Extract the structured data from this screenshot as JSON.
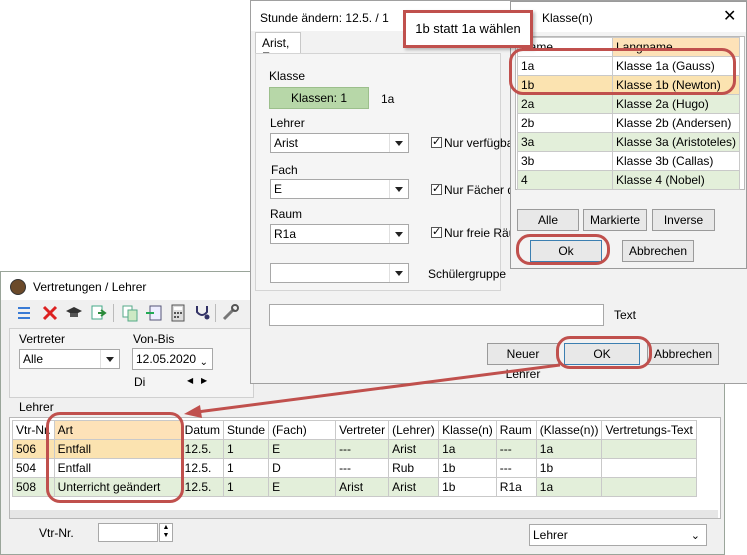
{
  "vertretungen": {
    "title": "Vertretungen / Lehrer",
    "vertreter_label": "Vertreter",
    "vertreter_value": "Alle",
    "vonbis_label": "Von-Bis",
    "date_value": "12.05.2020",
    "day_value": "Di",
    "lehrer_label": "Lehrer",
    "columns": [
      "Vtr-Nr.",
      "Art",
      "Datum",
      "Stunde",
      "(Fach)",
      "Vertreter",
      "(Lehrer)",
      "Klasse(n)",
      "Raum",
      "(Klasse(n))",
      "Vertretungs-Text"
    ],
    "rows": [
      [
        "506",
        "Entfall",
        "12.5.",
        "1",
        "E",
        "---",
        "Arist",
        "1a",
        "---",
        "1a",
        ""
      ],
      [
        "504",
        "Entfall",
        "12.5.",
        "1",
        "D",
        "---",
        "Rub",
        "1b",
        "---",
        "1b",
        ""
      ],
      [
        "508",
        "Unterricht geändert",
        "12.5.",
        "1",
        "E",
        "Arist",
        "Arist",
        "1b",
        "R1a",
        "1a",
        ""
      ]
    ],
    "vtr_nr_label": "Vtr-Nr.",
    "vtr_nr_value": "",
    "bottom_select": "Lehrer"
  },
  "stunde": {
    "title": "Stunde ändern:  12.5. / 1",
    "tab": "Arist, E",
    "klasse_label": "Klasse",
    "klassen_button": "Klassen: 1",
    "klasse_value": "1a",
    "lehrer_label": "Lehrer",
    "lehrer_value": "Arist",
    "chk_lehrer": "Nur verfügbare",
    "fach_label": "Fach",
    "fach_value": "E",
    "chk_fach": "Nur Fächer des",
    "raum_label": "Raum",
    "raum_value": "R1a",
    "chk_raum": "Nur freie Räum",
    "schuelergruppe_label": "Schülergruppe",
    "schuelergruppe_value": "",
    "text_label": "Text",
    "text_value": "",
    "btn_neuer_lehrer": "Neuer Lehrer",
    "btn_ok": "OK",
    "btn_abbrechen": "Abbrechen"
  },
  "klasse_dialog": {
    "title": "Klasse(n)",
    "col_name": "Name",
    "col_langname": "Langname",
    "rows": [
      [
        "1a",
        "Klasse 1a (Gauss)"
      ],
      [
        "1b",
        "Klasse 1b (Newton)"
      ],
      [
        "2a",
        "Klasse 2a (Hugo)"
      ],
      [
        "2b",
        "Klasse 2b (Andersen)"
      ],
      [
        "3a",
        "Klasse 3a (Aristoteles)"
      ],
      [
        "3b",
        "Klasse 3b (Callas)"
      ],
      [
        "4",
        "Klasse 4 (Nobel)"
      ]
    ],
    "btn_alle": "Alle",
    "btn_markierte": "Markierte",
    "btn_inverse": "Inverse",
    "btn_ok": "Ok",
    "btn_abbrechen": "Abbrechen"
  },
  "callout": {
    "text": "1b statt 1a wählen"
  },
  "colors": {
    "selected_row": "#fbe3b0",
    "green_row": "#e3efda",
    "klassen_button": "#b7d7a8",
    "annotation_red": "#c0504d",
    "header_orange": "#fde2b8"
  }
}
